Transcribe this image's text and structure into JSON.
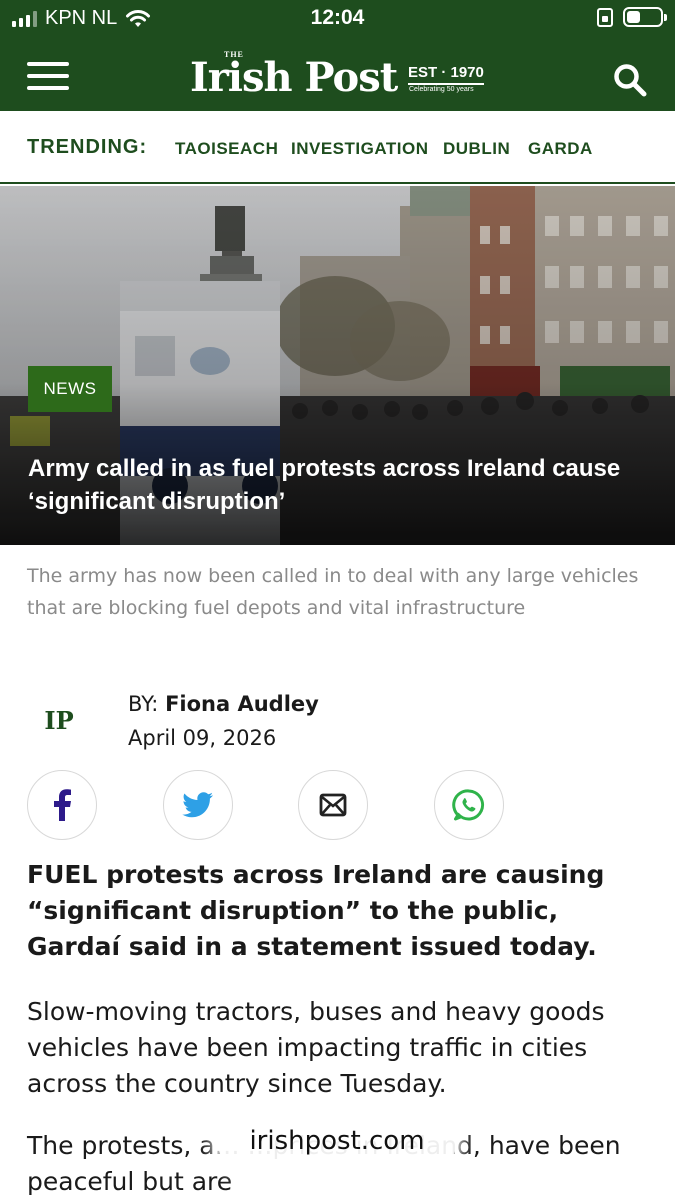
{
  "status_bar": {
    "carrier": "KPN NL",
    "time": "12:04",
    "battery_level": 0.4
  },
  "header": {
    "logo_the": "THE",
    "logo_name": "Irish Post",
    "logo_est": "EST · 1970",
    "logo_tagline": "Celebrating 50 years",
    "menu_icon": "hamburger-menu-icon",
    "search_icon": "search-icon"
  },
  "trending": {
    "label": "TRENDING:",
    "tags": [
      "TAOISEACH",
      "INVESTIGATION",
      "DUBLIN",
      "GARDA"
    ]
  },
  "article": {
    "category": "NEWS",
    "title": "Army called in as fuel protests across Ireland cause ‘significant disruption’",
    "summary": "The army has now been called in to deal with any large vehicles that are blocking fuel depots and vital infrastructure",
    "author_logo": "IP",
    "by_prefix": "BY: ",
    "author": "Fiona Audley",
    "date": "April 09, 2026",
    "lead": "FUEL protests across Ireland are causing “significant disruption” to the public, Gardaí said in a statement issued today.",
    "paragraph_1": "Slow-moving tractors, buses and heavy goods vehicles have been impacting traffic in cities across the country since Tuesday.",
    "paragraph_2": "The protests, a… …prices in Ireland, have been peaceful but are"
  },
  "share": {
    "icons": [
      "facebook-icon",
      "twitter-icon",
      "email-icon",
      "whatsapp-icon"
    ]
  },
  "browser": {
    "url": "irishpost.com"
  },
  "colors": {
    "brand_green": "#1e4d1e",
    "badge_green": "#2d6a1a"
  }
}
